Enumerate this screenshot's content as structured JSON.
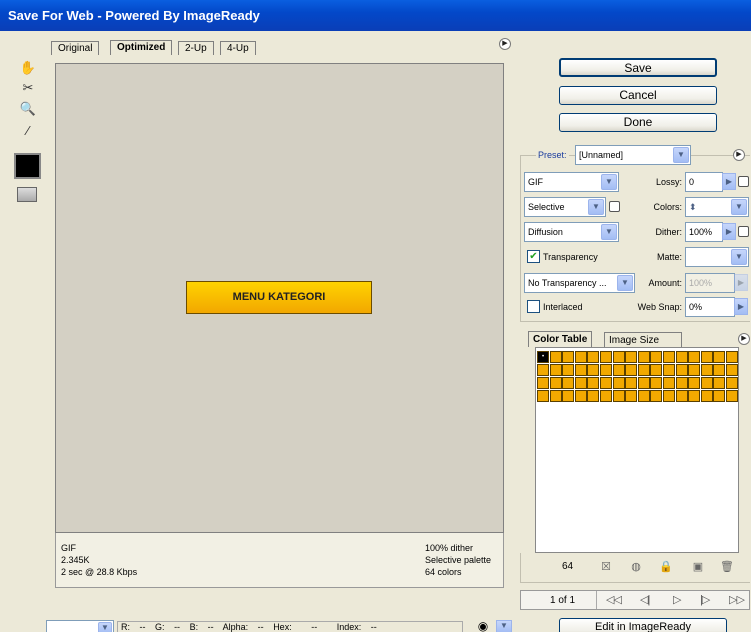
{
  "window": {
    "title": "Save For Web - Powered By ImageReady"
  },
  "tabs": [
    {
      "label": "Original"
    },
    {
      "label": "Optimized"
    },
    {
      "label": "2-Up"
    },
    {
      "label": "4-Up"
    }
  ],
  "preview": {
    "button_text": "MENU KATEGORI"
  },
  "info": {
    "format": "GIF",
    "size": "2.345K",
    "time": "2 sec @ 28.8 Kbps",
    "dither": "100% dither",
    "palette": "Selective palette",
    "colors": "64 colors"
  },
  "buttons": {
    "save": "Save",
    "cancel": "Cancel",
    "done": "Done",
    "edit": "Edit in ImageReady"
  },
  "settings": {
    "preset_label": "Preset:",
    "preset_value": "[Unnamed]",
    "format": "GIF",
    "lossy_label": "Lossy:",
    "lossy_value": "0",
    "reduction": "Selective",
    "colors_label": "Colors:",
    "dither_algo": "Diffusion",
    "dither_label": "Dither:",
    "dither_value": "100%",
    "transparency_label": "Transparency",
    "matte_label": "Matte:",
    "transparency_dither": "No Transparency ...",
    "amount_label": "Amount:",
    "amount_value": "100%",
    "interlaced_label": "Interlaced",
    "websnap_label": "Web Snap:",
    "websnap_value": "0%"
  },
  "colortable": {
    "tab_color": "Color Table",
    "tab_size": "Image Size",
    "count": "64",
    "swatch_color": "#f2a900"
  },
  "pager": {
    "text": "1 of 1"
  },
  "statusbar": {
    "r": "R:",
    "g": "G:",
    "b": "B:",
    "alpha": "Alpha:",
    "hex": "Hex:",
    "index": "Index:",
    "dash": "--"
  }
}
